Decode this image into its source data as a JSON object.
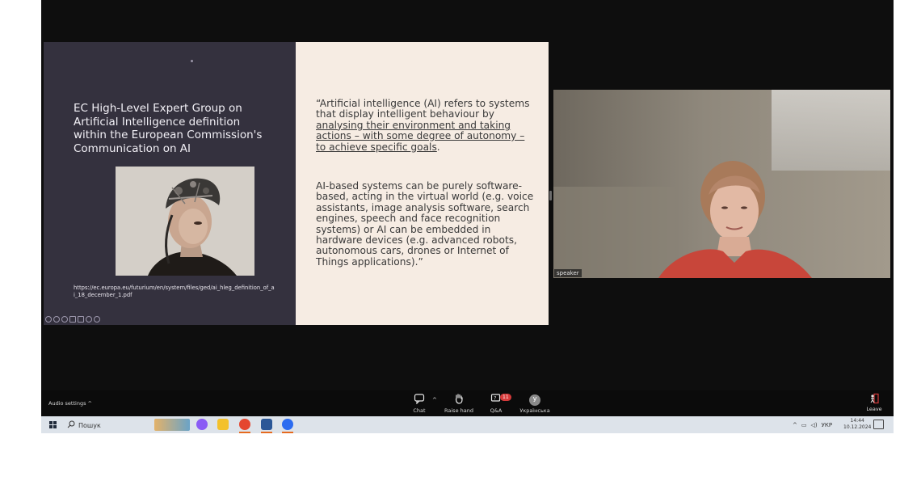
{
  "slide": {
    "title": "EC High-Level Expert Group on Artificial Intelligence definition within the European Commission's Communication on AI",
    "url": "https://ec.europa.eu/futurium/en/system/files/ged/ai_hleg_definition_of_ai_18_december_1.pdf",
    "quote1_part1": "“Artificial intelligence (AI) refers to systems that display intelligent behaviour by ",
    "quote1_underlined": "analysing their environment and taking actions – with some degree of autonomy – to achieve specific goals",
    "quote1_end": ".",
    "quote2": "AI-based systems can be purely software-based, acting in the virtual world (e.g. voice assistants, image analysis software, search engines, speech and face recognition systems) or AI can be embedded in hardware devices (e.g. advanced robots, autonomous cars, drones or Internet of Things applications).”"
  },
  "video": {
    "label": "speaker"
  },
  "meeting_bar": {
    "audio_settings": "Audio settings",
    "chat": "Chat",
    "raise_hand": "Raise hand",
    "qa": "Q&A",
    "qa_badge": "11",
    "language": "Українська",
    "language_avatar": "У",
    "leave": "Leave"
  },
  "taskbar": {
    "search_placeholder": "Пошук",
    "lang": "УКР",
    "time": "14:44",
    "date": "10.12.2024"
  },
  "colors": {
    "slide_left_bg": "#34313e",
    "slide_right_bg": "#f6ece3",
    "badge": "#d63a3a",
    "leave_icon": "#d63a3a"
  }
}
